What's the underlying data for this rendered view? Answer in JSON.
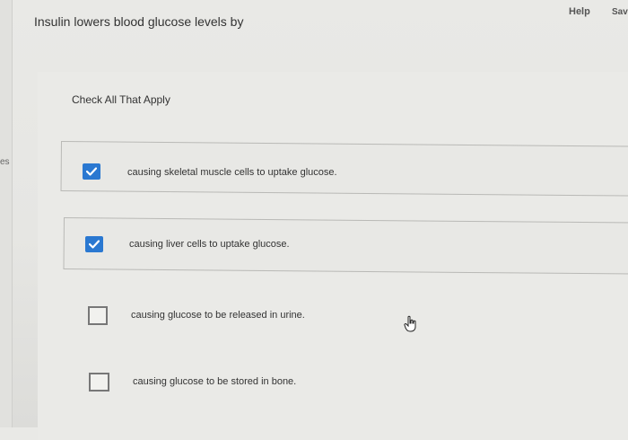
{
  "header": {
    "help_label": "Help",
    "save_label": "Save"
  },
  "sidebar": {
    "tab_fragment": "es"
  },
  "question": {
    "prompt": "Insulin lowers blood glucose levels by",
    "instruction": "Check All That Apply",
    "options": [
      {
        "label": "causing skeletal muscle cells to uptake glucose.",
        "checked": true
      },
      {
        "label": "causing liver cells to uptake glucose.",
        "checked": true
      },
      {
        "label": "causing glucose to be released in urine.",
        "checked": false
      },
      {
        "label": "causing glucose to be stored in bone.",
        "checked": false
      }
    ]
  },
  "colors": {
    "checked_box": "#2a78d1",
    "background": "#e9e9e6"
  },
  "icons": {
    "check": "checkmark-icon",
    "cursor": "hand-pointer-icon"
  }
}
